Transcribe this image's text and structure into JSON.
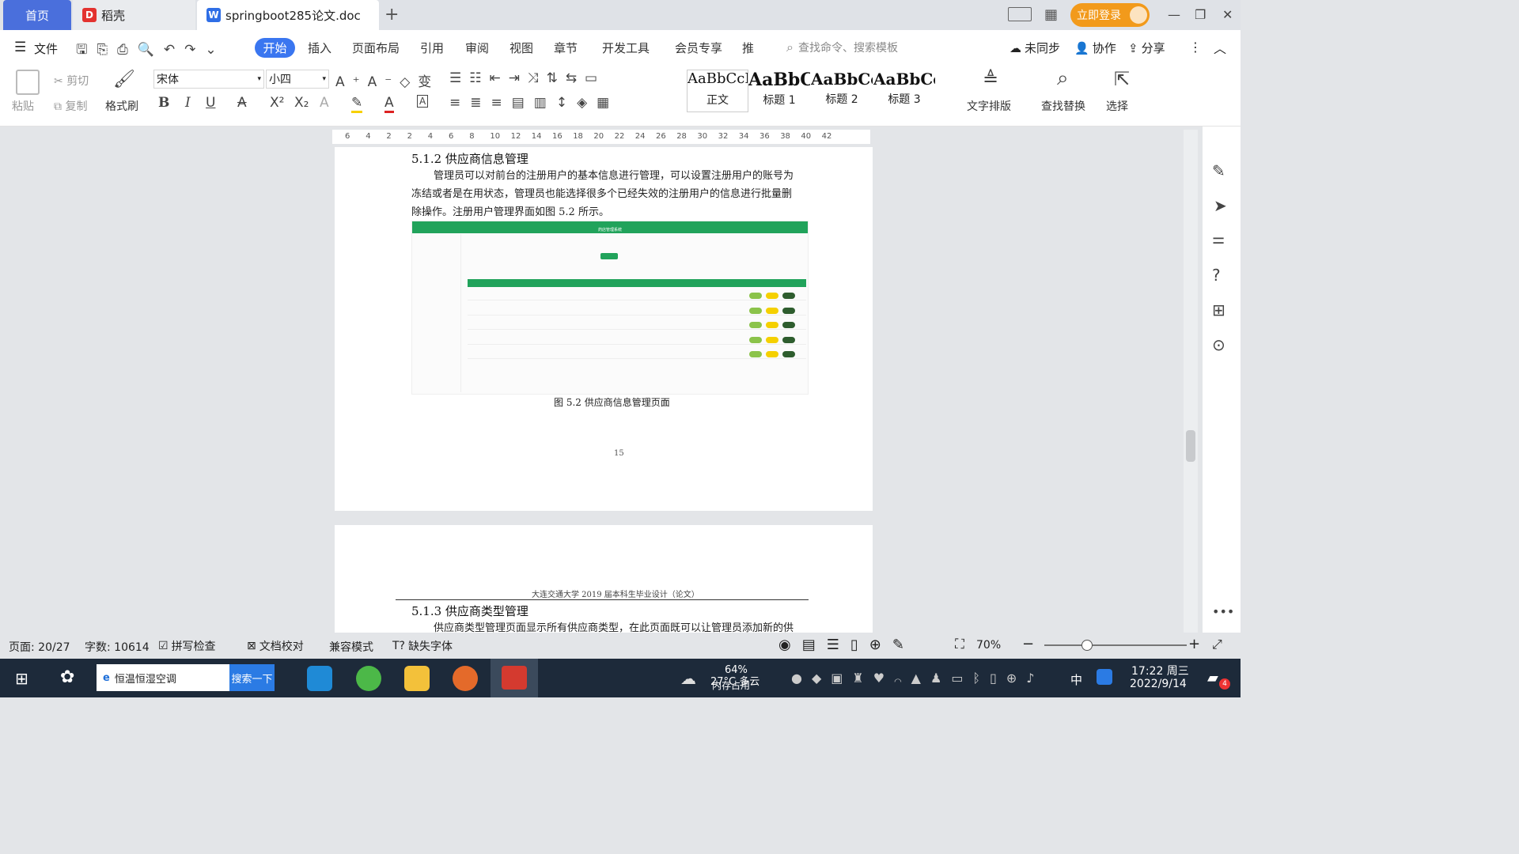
{
  "titlebar": {
    "home_tab": "首页",
    "daoke_tab": "稻壳",
    "doc_tab": "springboot285论文.doc",
    "add_tab": "+",
    "login": "立即登录"
  },
  "menu": {
    "file": "文件",
    "items": [
      "开始",
      "插入",
      "页面布局",
      "引用",
      "审阅",
      "视图",
      "章节",
      "开发工具",
      "会员专享",
      "推"
    ],
    "search_placeholder": "查找命令、搜索模板",
    "sync": "未同步",
    "collab": "协作",
    "share": "分享"
  },
  "ribbon": {
    "paste": "粘贴",
    "cut": "剪切",
    "copy": "复制",
    "format_painter": "格式刷",
    "font": "宋体",
    "size": "小四",
    "styles": [
      {
        "preview": "AaBbCcI",
        "name": "正文"
      },
      {
        "preview": "AaBbC",
        "name": "标题 1"
      },
      {
        "preview": "AaBbCc",
        "name": "标题 2"
      },
      {
        "preview": "AaBbCc",
        "name": "标题 3"
      }
    ],
    "text_layout": "文字排版",
    "find_replace": "查找替换",
    "select": "选择"
  },
  "ruler": {
    "ticks": [
      "6",
      "4",
      "2",
      "2",
      "4",
      "6",
      "8",
      "10",
      "12",
      "14",
      "16",
      "18",
      "20",
      "22",
      "24",
      "26",
      "28",
      "30",
      "32",
      "34",
      "36",
      "38",
      "40",
      "42"
    ]
  },
  "document": {
    "heading1": "5.1.2  供应商信息管理",
    "para_lines": [
      "管理员可以对前台的注册用户的基本信息进行管理，可以设置注册用户的账号为",
      "冻结或者是在用状态，管理员也能选择很多个已经失效的注册用户的信息进行批量删",
      "除操作。注册用户管理界面如图 5.2 所示。"
    ],
    "figure_caption": "图 5.2  供应商信息管理页面",
    "page_number": "15",
    "page2_header": "大连交通大学 2019 届本科生毕业设计（论文）",
    "heading2": "5.1.3  供应商类型管理",
    "para2": "供应商类型管理页面显示所有供应商类型，在此页面既可以让管理员添加新的供"
  },
  "embedded_shot": {
    "title": "药店管理系统",
    "rows": 5
  },
  "statusbar": {
    "page": "页面: 20/27",
    "words": "字数: 10614",
    "spell": "拼写检查",
    "proof": "文档校对",
    "compat": "兼容模式",
    "missing_font": "缺失字体",
    "zoom": "70%"
  },
  "taskbar": {
    "search_text": "恒温恒湿空调",
    "search_btn": "搜索一下",
    "weather": "27°C 多云",
    "mem": "64%",
    "mem_label": "内存占用",
    "ime": "中",
    "time": "17:22 周三",
    "date": "2022/9/14",
    "badge": "4"
  },
  "colors": {
    "accent": "#3a76f0",
    "green": "#1aa260",
    "login": "#f29a1b"
  }
}
